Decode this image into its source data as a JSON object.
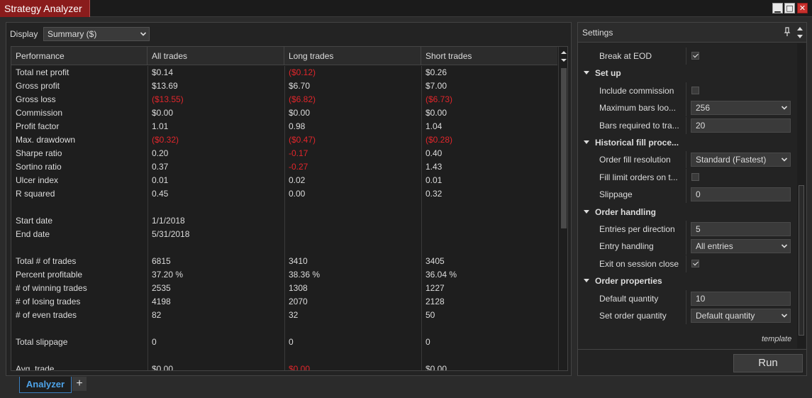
{
  "window": {
    "title": "Strategy Analyzer",
    "minimize_glyph": "▁",
    "maximize_glyph": "□",
    "close_glyph": "✕"
  },
  "display": {
    "label": "Display",
    "selected": "Summary ($)"
  },
  "grid": {
    "columns": [
      "Performance",
      "All trades",
      "Long trades",
      "Short trades"
    ],
    "rows": [
      {
        "label": "Total net profit",
        "all": "$0.14",
        "long": "($0.12)",
        "short": "$0.26",
        "neg": [
          false,
          true,
          false
        ]
      },
      {
        "label": "Gross profit",
        "all": "$13.69",
        "long": "$6.70",
        "short": "$7.00",
        "neg": [
          false,
          false,
          false
        ]
      },
      {
        "label": "Gross loss",
        "all": "($13.55)",
        "long": "($6.82)",
        "short": "($6.73)",
        "neg": [
          true,
          true,
          true
        ]
      },
      {
        "label": "Commission",
        "all": "$0.00",
        "long": "$0.00",
        "short": "$0.00",
        "neg": [
          false,
          false,
          false
        ]
      },
      {
        "label": "Profit factor",
        "all": "1.01",
        "long": "0.98",
        "short": "1.04",
        "neg": [
          false,
          false,
          false
        ]
      },
      {
        "label": "Max. drawdown",
        "all": "($0.32)",
        "long": "($0.47)",
        "short": "($0.28)",
        "neg": [
          true,
          true,
          true
        ]
      },
      {
        "label": "Sharpe ratio",
        "all": "0.20",
        "long": "-0.17",
        "short": "0.40",
        "neg": [
          false,
          true,
          false
        ]
      },
      {
        "label": "Sortino ratio",
        "all": "0.37",
        "long": "-0.27",
        "short": "1.43",
        "neg": [
          false,
          true,
          false
        ]
      },
      {
        "label": "Ulcer index",
        "all": "0.01",
        "long": "0.02",
        "short": "0.01",
        "neg": [
          false,
          false,
          false
        ]
      },
      {
        "label": "R squared",
        "all": "0.45",
        "long": "0.00",
        "short": "0.32",
        "neg": [
          false,
          false,
          false
        ]
      },
      {
        "label": "",
        "all": "",
        "long": "",
        "short": "",
        "neg": [
          false,
          false,
          false
        ]
      },
      {
        "label": "Start date",
        "all": "1/1/2018",
        "long": "",
        "short": "",
        "neg": [
          false,
          false,
          false
        ]
      },
      {
        "label": "End date",
        "all": "5/31/2018",
        "long": "",
        "short": "",
        "neg": [
          false,
          false,
          false
        ]
      },
      {
        "label": "",
        "all": "",
        "long": "",
        "short": "",
        "neg": [
          false,
          false,
          false
        ]
      },
      {
        "label": "Total # of trades",
        "all": "6815",
        "long": "3410",
        "short": "3405",
        "neg": [
          false,
          false,
          false
        ]
      },
      {
        "label": "Percent profitable",
        "all": "37.20 %",
        "long": "38.36 %",
        "short": "36.04 %",
        "neg": [
          false,
          false,
          false
        ]
      },
      {
        "label": "# of winning trades",
        "all": "2535",
        "long": "1308",
        "short": "1227",
        "neg": [
          false,
          false,
          false
        ]
      },
      {
        "label": "# of losing trades",
        "all": "4198",
        "long": "2070",
        "short": "2128",
        "neg": [
          false,
          false,
          false
        ]
      },
      {
        "label": "# of even trades",
        "all": "82",
        "long": "32",
        "short": "50",
        "neg": [
          false,
          false,
          false
        ]
      },
      {
        "label": "",
        "all": "",
        "long": "",
        "short": "",
        "neg": [
          false,
          false,
          false
        ]
      },
      {
        "label": "Total slippage",
        "all": "0",
        "long": "0",
        "short": "0",
        "neg": [
          false,
          false,
          false
        ]
      },
      {
        "label": "",
        "all": "",
        "long": "",
        "short": "",
        "neg": [
          false,
          false,
          false
        ]
      },
      {
        "label": "Avg. trade",
        "all": "$0.00",
        "long": "$0.00",
        "short": "$0.00",
        "neg": [
          false,
          true,
          false
        ]
      }
    ]
  },
  "settings": {
    "title": "Settings",
    "template_label": "template",
    "run_label": "Run",
    "rows": [
      {
        "kind": "check",
        "label": "Break at EOD",
        "checked": true
      },
      {
        "kind": "cat",
        "label": "Set up"
      },
      {
        "kind": "check",
        "label": "Include commission",
        "checked": false
      },
      {
        "kind": "select",
        "label": "Maximum bars loo...",
        "value": "256"
      },
      {
        "kind": "text",
        "label": "Bars required to tra...",
        "value": "20"
      },
      {
        "kind": "cat",
        "label": "Historical fill proce..."
      },
      {
        "kind": "select",
        "label": "Order fill resolution",
        "value": "Standard (Fastest)"
      },
      {
        "kind": "check",
        "label": "Fill limit orders on t...",
        "checked": false
      },
      {
        "kind": "text",
        "label": "Slippage",
        "value": "0"
      },
      {
        "kind": "cat",
        "label": "Order handling"
      },
      {
        "kind": "text",
        "label": "Entries per direction",
        "value": "5"
      },
      {
        "kind": "select",
        "label": "Entry handling",
        "value": "All entries"
      },
      {
        "kind": "check",
        "label": "Exit on session close",
        "checked": true
      },
      {
        "kind": "cat",
        "label": "Order properties"
      },
      {
        "kind": "text",
        "label": "Default quantity",
        "value": "10"
      },
      {
        "kind": "select",
        "label": "Set order quantity",
        "value": "Default quantity"
      }
    ]
  },
  "tabs": {
    "active": "Analyzer",
    "add": "+"
  }
}
